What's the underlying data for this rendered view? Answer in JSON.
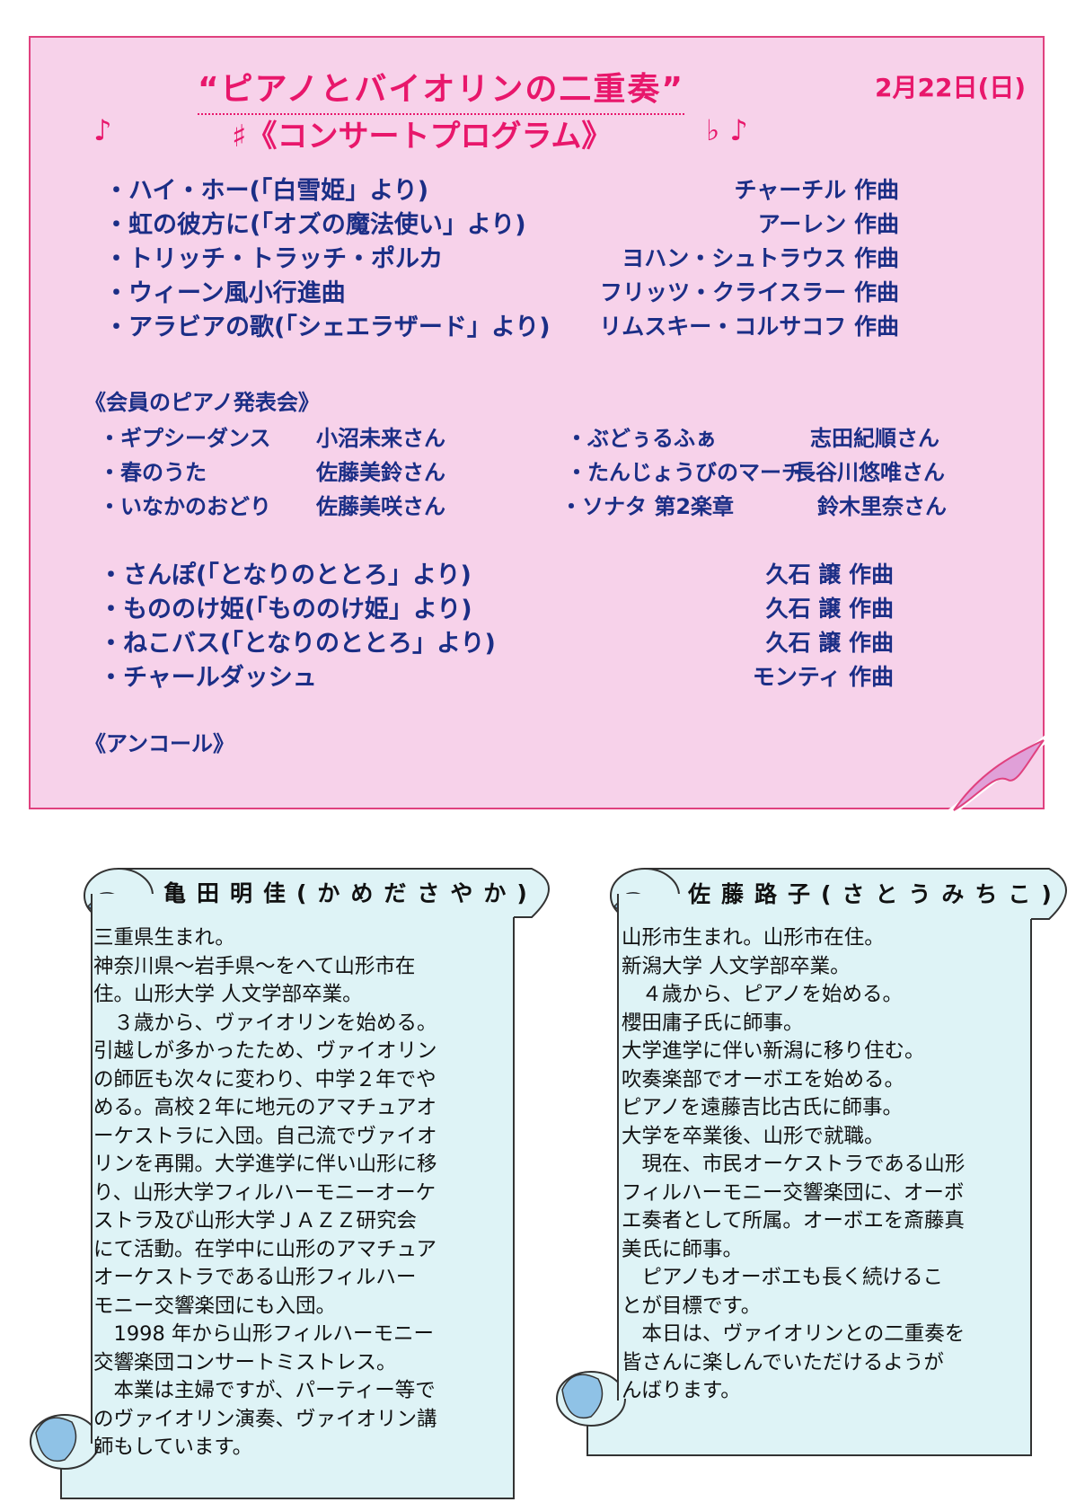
{
  "program": {
    "title": "“ピアノとバイオリンの二重奏”",
    "date": "2月22日(日)",
    "note_left": "♪",
    "subtitle": "♯《コンサートプログラム》",
    "flat_note": "♭ ♪",
    "items": [
      {
        "title": "・ハイ・ホー(「白雪姫」より)",
        "composer": "チャーチル 作曲"
      },
      {
        "title": "・虹の彼方に(「オズの魔法使い」より)",
        "composer": "アーレン 作曲"
      },
      {
        "title": "・トリッチ・トラッチ・ポルカ",
        "composer": "ヨハン・シュトラウス 作曲"
      },
      {
        "title": "・ウィーン風小行進曲",
        "composer": "フリッツ・クライスラー 作曲"
      },
      {
        "title": "・アラビアの歌(「シェエラザード」より)",
        "composer": "リムスキー・コルサコフ 作曲"
      }
    ]
  },
  "recital": {
    "heading": "《会員のピアノ発表会》",
    "left": [
      {
        "piece": "・ギプシーダンス",
        "performer": "小沼未来さん"
      },
      {
        "piece": "・春のうた",
        "performer": "佐藤美鈴さん"
      },
      {
        "piece": "・いなかのおどり",
        "performer": "佐藤美咲さん"
      }
    ],
    "right": [
      {
        "piece": "・ぶどぅるふぁ",
        "performer": "志田紀順さん"
      },
      {
        "piece": "・たんじょうびのマーチ",
        "performer": "長谷川悠唯さん"
      },
      {
        "piece": "・ソナタ 第2楽章",
        "performer": "鈴木里奈さん"
      }
    ]
  },
  "program2": {
    "items": [
      {
        "title": "・さんぽ(「となりのととろ」より)",
        "composer": "久石 譲 作曲"
      },
      {
        "title": "・もののけ姫(「もののけ姫」より)",
        "composer": "久石 譲 作曲"
      },
      {
        "title": "・ねこバス(「となりのととろ」より)",
        "composer": "久石 譲 作曲"
      },
      {
        "title": "・チャールダッシュ",
        "composer": "モンティ 作曲"
      }
    ],
    "encore": "《アンコール》"
  },
  "profiles": {
    "left": {
      "name": "亀田明佳(かめださやか)",
      "lines": [
        "三重県生まれ。",
        "神奈川県～岩手県～をへて山形市在",
        "住。山形大学 人文学部卒業。",
        "　３歳から、ヴァイオリンを始める。",
        "引越しが多かったため、ヴァイオリン",
        "の師匠も次々に変わり、中学２年でや",
        "める。高校２年に地元のアマチュアオ",
        "ーケストラに入団。自己流でヴァイオ",
        "リンを再開。大学進学に伴い山形に移",
        "り、山形大学フィルハーモニーオーケ",
        "ストラ及び山形大学ＪＡＺＺ研究会",
        "にて活動。在学中に山形のアマチュア",
        "オーケストラである山形フィルハー",
        "モニー交響楽団にも入団。",
        "　1998 年から山形フィルハーモニー",
        "交響楽団コンサートミストレス。",
        "　本業は主婦ですが、パーティー等で",
        "のヴァイオリン演奏、ヴァイオリン講",
        "師もしています。"
      ]
    },
    "right": {
      "name": "佐藤路子(さとうみちこ)",
      "lines": [
        "山形市生まれ。山形市在住。",
        "新潟大学 人文学部卒業。",
        "　４歳から、ピアノを始める。",
        "櫻田庸子氏に師事。",
        "大学進学に伴い新潟に移り住む。",
        "吹奏楽部でオーボエを始める。",
        "ピアノを遠藤吉比古氏に師事。",
        "大学を卒業後、山形で就職。",
        "　現在、市民オーケストラである山形",
        "フィルハーモニー交響楽団に、オーボ",
        "エ奏者として所属。オーボエを斎藤真",
        "美氏に師事。",
        "　ピアノもオーボエも長く続けるこ",
        "とが目標です。",
        "　本日は、ヴァイオリンとの二重奏を",
        "皆さんに楽しんでいただけるようが",
        "んばります。"
      ]
    }
  },
  "colors": {
    "card_bg": "#f7d2ea",
    "accent_pink": "#e8176b",
    "navy_text": "#1b2e86",
    "scroll_bg": "#def3f6",
    "scroll_curl": "#8fc2e6"
  }
}
